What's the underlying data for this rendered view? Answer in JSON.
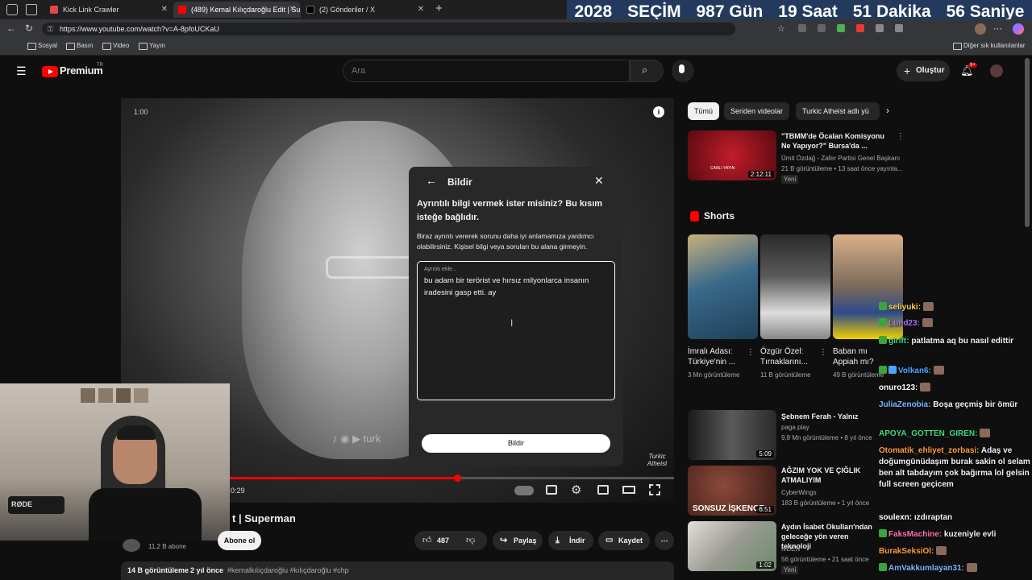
{
  "tabs": [
    {
      "label": "Kick Link Crawler",
      "color": "#e04848"
    },
    {
      "label": "(489) Kemal Kılıçdaroğlu Edit | Su",
      "color": "#ff0000"
    },
    {
      "label": "(2) Gönderiler / X",
      "color": "#000000"
    }
  ],
  "countdown": {
    "year": "2028",
    "title": "SEÇİM",
    "days": "987 Gün",
    "hours": "19 Saat",
    "minutes": "51 Dakika",
    "seconds": "56 Saniye"
  },
  "address": {
    "url": "https://www.youtube.com/watch?v=A-8pfoUCKaU"
  },
  "bookmarks": [
    "Sosyal",
    "Basın",
    "Video",
    "Yayın"
  ],
  "bookmarks_other": "Diğer sık kullanılanlar",
  "yt": {
    "logo": "Premium",
    "logo_sup": "TR",
    "search_placeholder": "Ara",
    "create": "Oluştur",
    "notif_count": "9+"
  },
  "video": {
    "time": "1:00",
    "time2": "0:29",
    "title_partial": "t | Superman",
    "watermark": "Turkic Atheist",
    "progress": 0.61
  },
  "dialog": {
    "title": "Bildir",
    "heading": "Ayrıntılı bilgi vermek ister misiniz? Bu kısım isteğe bağlıdır.",
    "desc": "Biraz ayrıntı vererek sorunu daha iyi anlamamıza yardımcı olabilirsiniz. Kişisel bilgi veya soruları bu alana girmeyin.",
    "field_label": "Ayrıntı ekle...",
    "field_value": "bu adam bir terörist ve hırsız milyonlarca insanın iradesini gasp etti. ay",
    "submit": "Bildir"
  },
  "below_video": {
    "subscribers": "11,2 B abone",
    "subscribe": "Abone ol",
    "likes": "487",
    "share": "Paylaş",
    "download": "İndir",
    "save": "Kaydet",
    "views": "14 B görüntüleme",
    "ago": "2 yıl önce",
    "tags": "#kemalkılıçdaroğlu #kılıçdaroğlu #chp"
  },
  "chips": [
    "Tümü",
    "Seriden videolar",
    "Turkic Atheist adlı yü"
  ],
  "sidebar_top": {
    "title": "\"TBMM'de Öcalan Komisyonu Ne Yapıyor?\" Bursa'da ...",
    "channel": "Ümit Özdağ - Zafer Partisi Genel Başkanı",
    "meta": "21 B görüntüleme • 13 saat önce yayınla...",
    "badge": "Yeni",
    "duration": "2:12:11",
    "thumb_text": "CANLI YAYIN"
  },
  "shorts": {
    "heading": "Shorts",
    "items": [
      {
        "title": "İmralı Adası: Türkiye'nin ...",
        "views": "3 Mn görüntüleme"
      },
      {
        "title": "Özgür Özel: Tırnaklarını...",
        "views": "11 B görüntüleme"
      },
      {
        "title": "Baban mı Appiah mı?",
        "views": "49 B görüntüleme"
      }
    ]
  },
  "sidebar_videos": [
    {
      "title": "Şebnem Ferah - Yalnız",
      "channel": "paga play",
      "meta": "9,8 Mn görüntüleme • 8 yıl önce",
      "duration": "5:09",
      "color": "#3a3a3a"
    },
    {
      "title": "AĞZIM YOK VE ÇIĞLIK ATMALIYIM",
      "channel": "CyberWings",
      "meta": "183 B görüntüleme • 1 yıl önce",
      "duration": "6:51",
      "color": "#5a3a30",
      "thumb_text": "SONSUZ İŞKENCE"
    },
    {
      "title": "Aydın İsabet Okulları'ndan geleceğe yön veren teknoloji",
      "channel": "tvDEN",
      "meta": "56 görüntüleme • 21 saat önce",
      "badge": "Yeni",
      "duration": "1:02",
      "color": "#c0c0b8"
    }
  ],
  "chat": [
    {
      "user": "seliyuki:",
      "msg": "",
      "color": "#ffd24d"
    },
    {
      "user": "Lund23:",
      "msg": "",
      "color": "#a970ff"
    },
    {
      "user": "girlft:",
      "msg": "patlatma aq bu nasıl edittir",
      "color": "#3ddc84"
    },
    {
      "user": "Volkan6:",
      "msg": "",
      "color": "#4da6ff"
    },
    {
      "user": "onuro123:",
      "msg": "",
      "color": "#ffffff"
    },
    {
      "user": "JuliaZenobia:",
      "msg": "Boşa geçmiş bir ömür",
      "color": "#7ab8ff"
    },
    {
      "user": "APOYA_GOTTEN_GIREN:",
      "msg": "",
      "color": "#3ddc84"
    },
    {
      "user": "Otomatik_ehliyet_zorbasi:",
      "msg": "Adaş ve doğumgünüdaşım burak sakin ol selam ben alt tabdayım çok bağırma lol gelsin full screen geçicem",
      "color": "#ff9d3d"
    },
    {
      "user": "soulexn:",
      "msg": "ızdıraptan",
      "color": "#ffffff"
    },
    {
      "user": "FaksMachine:",
      "msg": "kuzeniyle evli",
      "color": "#ff6fb0"
    },
    {
      "user": "BurakSeksiOl:",
      "msg": "",
      "color": "#ff9d3d"
    },
    {
      "user": "AmVakkumlayan31:",
      "msg": "",
      "color": "#7ab8ff"
    }
  ]
}
